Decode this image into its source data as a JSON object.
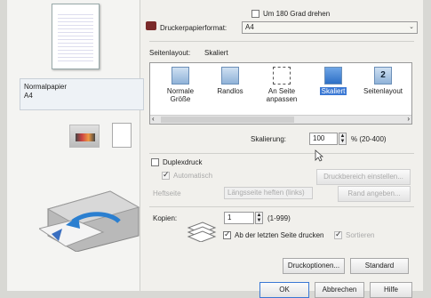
{
  "left": {
    "media_name": "Normalpapier",
    "media_size": "A4"
  },
  "rotate": {
    "label": "Um 180 Grad drehen",
    "checked": false
  },
  "paper_format": {
    "label": "Druckerpapierformat:",
    "value": "A4"
  },
  "page_layout": {
    "label": "Seitenlayout:",
    "current": "Skaliert",
    "items": [
      {
        "label": "Normale Größe",
        "selected": false
      },
      {
        "label": "Randlos",
        "selected": false
      },
      {
        "label": "An Seite anpassen",
        "selected": false
      },
      {
        "label": "Skaliert",
        "selected": true
      },
      {
        "label": "Seitenlayout",
        "selected": false
      }
    ]
  },
  "scaling": {
    "label": "Skalierung:",
    "value": "100",
    "unit": "% (20-400)"
  },
  "duplex": {
    "label": "Duplexdruck",
    "checked": false,
    "auto_label": "Automatisch",
    "print_area_button": "Druckbereich einstellen...",
    "binding_label": "Heftseite",
    "binding_value": "Längsseite heften (links)",
    "margin_button": "Rand angeben..."
  },
  "copies": {
    "label": "Kopien:",
    "value": "1",
    "range": "(1-999)",
    "last_page_first": "Ab der letzten Seite drucken",
    "last_page_checked": true,
    "collate": "Sortieren"
  },
  "buttons": {
    "print_options": "Druckoptionen...",
    "standard": "Standard",
    "ok": "OK",
    "cancel": "Abbrechen",
    "help": "Hilfe"
  }
}
